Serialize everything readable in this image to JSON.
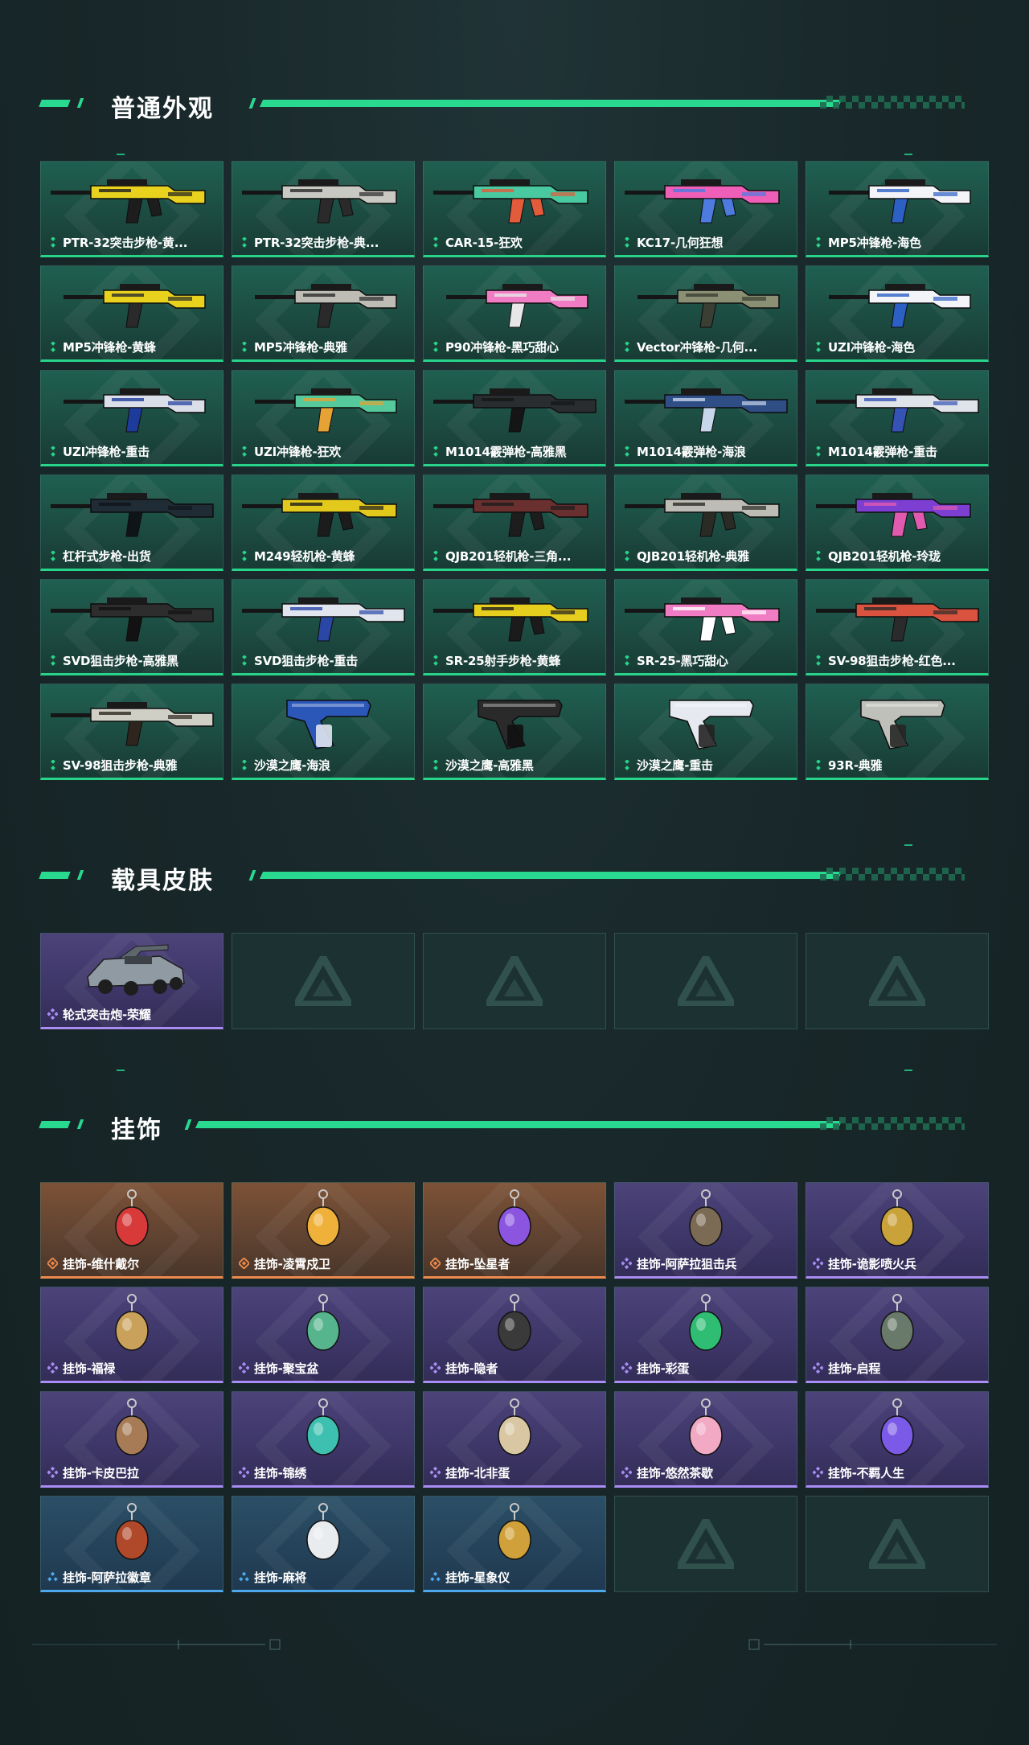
{
  "sections": {
    "weapons": {
      "title": "普通外观"
    },
    "vehicles": {
      "title": "载具皮肤"
    },
    "charms": {
      "title": "挂饰"
    }
  },
  "colors": {
    "accent": "#28d98f",
    "rarity_green": "#27d48a",
    "rarity_purple": "#a98cf4",
    "rarity_orange": "#ed8a4c",
    "rarity_blue": "#4ea8ee"
  },
  "weapons": [
    {
      "label": "PTR-32突击步枪-黄...",
      "rarity": "green",
      "icon": "rifle-yellow-camo"
    },
    {
      "label": "PTR-32突击步枪-典...",
      "rarity": "green",
      "icon": "rifle-silver"
    },
    {
      "label": "CAR-15-狂欢",
      "rarity": "green",
      "icon": "rifle-carnival"
    },
    {
      "label": "KC17-几何狂想",
      "rarity": "green",
      "icon": "rifle-pink-geometric"
    },
    {
      "label": "MP5冲锋枪-海色",
      "rarity": "green",
      "icon": "smg-white-blue"
    },
    {
      "label": "MP5冲锋枪-黄蜂",
      "rarity": "green",
      "icon": "smg-yellow"
    },
    {
      "label": "MP5冲锋枪-典雅",
      "rarity": "green",
      "icon": "smg-silver"
    },
    {
      "label": "P90冲锋枪-黑巧甜心",
      "rarity": "green",
      "icon": "smg-pink-p90"
    },
    {
      "label": "Vector冲锋枪-几何...",
      "rarity": "green",
      "icon": "smg-vector-camo"
    },
    {
      "label": "UZI冲锋枪-海色",
      "rarity": "green",
      "icon": "smg-uzi-white"
    },
    {
      "label": "UZI冲锋枪-重击",
      "rarity": "green",
      "icon": "smg-uzi-blue"
    },
    {
      "label": "UZI冲锋枪-狂欢",
      "rarity": "green",
      "icon": "smg-uzi-carnival"
    },
    {
      "label": "M1014霰弹枪-高雅黑",
      "rarity": "green",
      "icon": "shotgun-black"
    },
    {
      "label": "M1014霰弹枪-海浪",
      "rarity": "green",
      "icon": "shotgun-wave"
    },
    {
      "label": "M1014霰弹枪-重击",
      "rarity": "green",
      "icon": "shotgun-white"
    },
    {
      "label": "杠杆式步枪-出货",
      "rarity": "green",
      "icon": "lever-rifle"
    },
    {
      "label": "M249轻机枪-黄蜂",
      "rarity": "green",
      "icon": "lmg-yellow"
    },
    {
      "label": "QJB201轻机枪-三角...",
      "rarity": "green",
      "icon": "lmg-triangle"
    },
    {
      "label": "QJB201轻机枪-典雅",
      "rarity": "green",
      "icon": "lmg-silver"
    },
    {
      "label": "QJB201轻机枪-玲珑",
      "rarity": "green",
      "icon": "lmg-purple"
    },
    {
      "label": "SVD狙击步枪-高雅黑",
      "rarity": "green",
      "icon": "sniper-black"
    },
    {
      "label": "SVD狙击步枪-重击",
      "rarity": "green",
      "icon": "sniper-white"
    },
    {
      "label": "SR-25射手步枪-黄蜂",
      "rarity": "green",
      "icon": "marksman-yellow"
    },
    {
      "label": "SR-25-黑巧甜心",
      "rarity": "green",
      "icon": "marksman-pink"
    },
    {
      "label": "SV-98狙击步枪-红色...",
      "rarity": "green",
      "icon": "sniper-red"
    },
    {
      "label": "SV-98狙击步枪-典雅",
      "rarity": "green",
      "icon": "sniper-silver"
    },
    {
      "label": "沙漠之鹰-海浪",
      "rarity": "green",
      "icon": "pistol-wave"
    },
    {
      "label": "沙漠之鹰-高雅黑",
      "rarity": "green",
      "icon": "pistol-black"
    },
    {
      "label": "沙漠之鹰-重击",
      "rarity": "green",
      "icon": "pistol-white"
    },
    {
      "label": "93R-典雅",
      "rarity": "green",
      "icon": "pistol-silver"
    }
  ],
  "vehicles": [
    {
      "label": "轮式突击炮-荣耀",
      "rarity": "purple",
      "icon": "armored-vehicle"
    }
  ],
  "charms": [
    {
      "label": "挂饰-维什戴尔",
      "rarity": "orange",
      "icon": "charm-bottle"
    },
    {
      "label": "挂饰-凌霄戍卫",
      "rarity": "orange",
      "icon": "charm-bird"
    },
    {
      "label": "挂饰-坠星者",
      "rarity": "orange",
      "icon": "charm-crystal"
    },
    {
      "label": "挂饰-阿萨拉狙击兵",
      "rarity": "purple",
      "icon": "charm-soldier"
    },
    {
      "label": "挂饰-诡影喷火兵",
      "rarity": "purple",
      "icon": "charm-flamer"
    },
    {
      "label": "挂饰-福禄",
      "rarity": "purple",
      "icon": "charm-gourd"
    },
    {
      "label": "挂饰-聚宝盆",
      "rarity": "purple",
      "icon": "charm-bowl"
    },
    {
      "label": "挂饰-隐者",
      "rarity": "purple",
      "icon": "charm-card"
    },
    {
      "label": "挂饰-彩蛋",
      "rarity": "purple",
      "icon": "charm-egg"
    },
    {
      "label": "挂饰-启程",
      "rarity": "purple",
      "icon": "charm-ring"
    },
    {
      "label": "挂饰-卡皮巴拉",
      "rarity": "purple",
      "icon": "charm-capybara"
    },
    {
      "label": "挂饰-锦绣",
      "rarity": "purple",
      "icon": "charm-butterfly"
    },
    {
      "label": "挂饰-北非蛋",
      "rarity": "purple",
      "icon": "charm-shakshuka"
    },
    {
      "label": "挂饰-悠然茶歇",
      "rarity": "purple",
      "icon": "charm-cupcake"
    },
    {
      "label": "挂饰-不羁人生",
      "rarity": "purple",
      "icon": "charm-sneaker"
    },
    {
      "label": "挂饰-阿萨拉徽章",
      "rarity": "blue",
      "icon": "charm-badge"
    },
    {
      "label": "挂饰-麻将",
      "rarity": "blue",
      "icon": "charm-mahjong"
    },
    {
      "label": "挂饰-星象仪",
      "rarity": "blue",
      "icon": "charm-astrolabe"
    }
  ]
}
